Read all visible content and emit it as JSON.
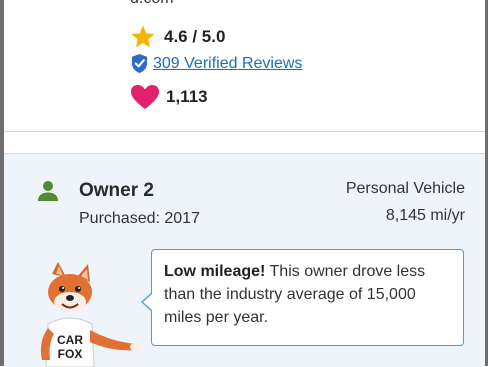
{
  "top_card": {
    "domain_fragment": "d.com",
    "rating": "4.6 / 5.0",
    "reviews_link": "309 Verified Reviews",
    "favorites_count": "1,113"
  },
  "owner": {
    "title": "Owner 2",
    "purchased": "Purchased: 2017",
    "vehicle_type": "Personal Vehicle",
    "mileage": "8,145 mi/yr"
  },
  "callout": {
    "bold_text": "Low mileage!",
    "body_text": " This owner drove less than the industry average of 15,000 miles per year."
  },
  "mascot": {
    "shirt_line1": "CAR",
    "shirt_line2": "FOX"
  },
  "colors": {
    "star": "#f5b400",
    "verified_badge": "#2c6fc2",
    "heart": "#e3206a",
    "link": "#1a6fb5",
    "person_icon": "#4f8a2e",
    "callout_border": "#4aa0d5",
    "owner_bg": "#eef4f9"
  },
  "icons": [
    "star-icon",
    "verified-check-icon",
    "heart-icon",
    "person-icon",
    "car-fox-mascot"
  ]
}
